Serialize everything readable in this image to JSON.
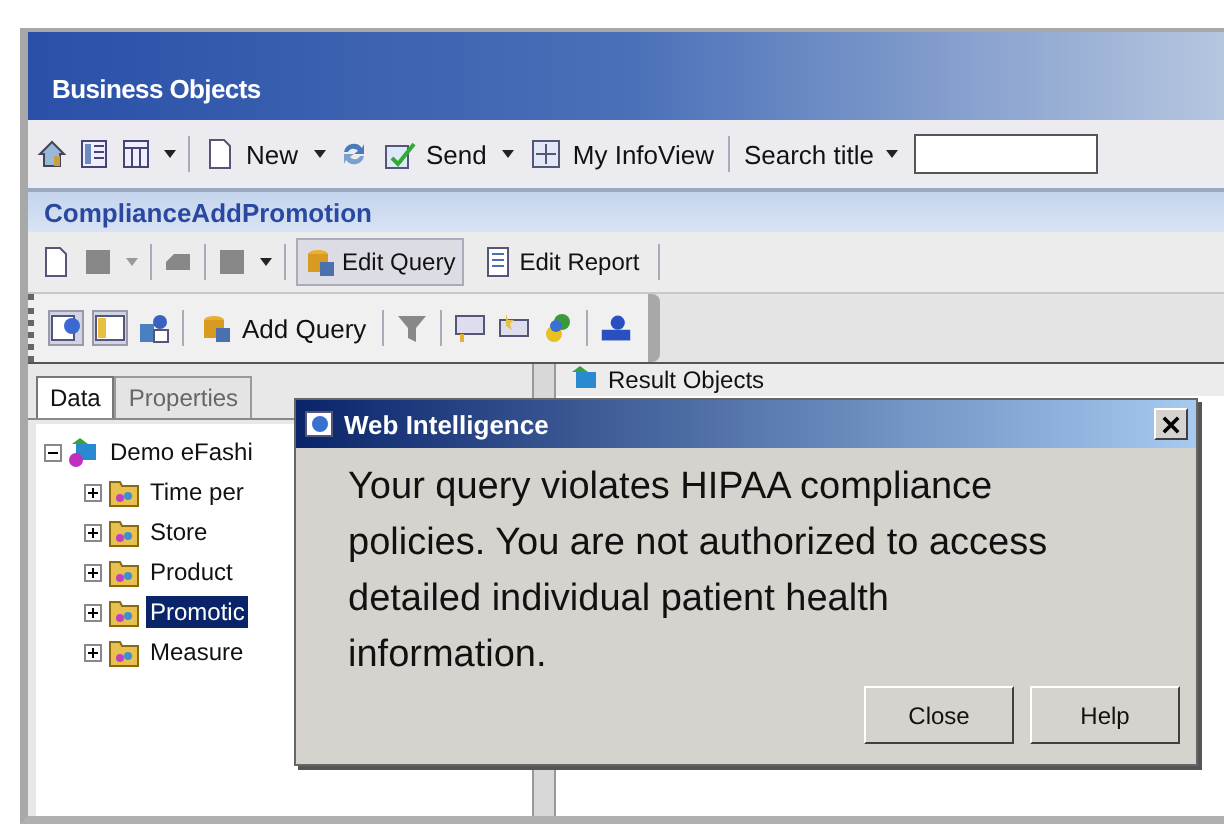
{
  "banner": {
    "logo": "Business Objects"
  },
  "main_toolbar": {
    "new": "New",
    "send": "Send",
    "infoview": "My InfoView",
    "search_scope": "Search title"
  },
  "document": {
    "title": "ComplianceAddPromotion"
  },
  "doc_toolbar": {
    "buttons": [
      {
        "label": "Edit Query",
        "selected": true
      },
      {
        "label": "Edit Report",
        "selected": false
      }
    ]
  },
  "query_toolbar": {
    "add_query": "Add Query"
  },
  "panel_tabs": [
    {
      "label": "Data",
      "selected": true
    },
    {
      "label": "Properties",
      "selected": false
    }
  ],
  "tree": {
    "label": "Demo eFashi",
    "expanded": true,
    "children": [
      {
        "label": "Time per",
        "expanded": false,
        "selected": false
      },
      {
        "label": "Store",
        "expanded": false,
        "selected": false
      },
      {
        "label": "Product",
        "expanded": false,
        "selected": false
      },
      {
        "label": "Promotic",
        "expanded": false,
        "selected": true
      },
      {
        "label": "Measure",
        "expanded": false,
        "selected": false
      }
    ]
  },
  "result_panel": {
    "title": "Result Objects"
  },
  "dialog": {
    "title": "Web Intelligence",
    "message": "Your query violates HIPAA compliance policies. You are not authorized to access detailed individual patient health information.",
    "buttons": [
      "Close",
      "Help"
    ]
  }
}
